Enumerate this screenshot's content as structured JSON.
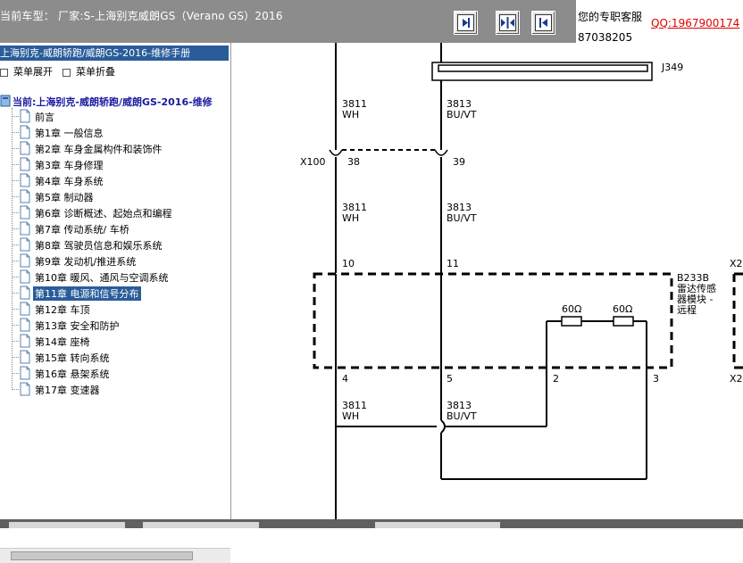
{
  "header": {
    "title": "当前车型： 厂家:S-上海别克威朗GS（Verano GS）2016",
    "buttons": [
      {
        "name": "first-page-button",
        "icon": "go-first-icon"
      },
      {
        "name": "split-view-button",
        "icon": "split-arrows-icon"
      },
      {
        "name": "previous-page-button",
        "icon": "go-back-icon"
      }
    ]
  },
  "support": {
    "label": "您的专职客服",
    "qq": "QQ:1967900174",
    "phone": "87038205"
  },
  "sidebar": {
    "header": "上海别克-威朗轿跑/威朗GS-2016-维修手册",
    "expand_menu": "菜单展开",
    "collapse_menu": "菜单折叠",
    "root": "当前:上海别克-威朗轿跑/威朗GS-2016-维修",
    "items": [
      {
        "label": "前言"
      },
      {
        "label": "第1章 一般信息"
      },
      {
        "label": "第2章 车身金属构件和装饰件"
      },
      {
        "label": "第3章 车身修理"
      },
      {
        "label": "第4章 车身系统"
      },
      {
        "label": "第5章 制动器"
      },
      {
        "label": "第6章 诊断概述、起始点和编程"
      },
      {
        "label": "第7章 传动系统/ 车桥"
      },
      {
        "label": "第8章 驾驶员信息和娱乐系统"
      },
      {
        "label": "第9章 发动机/推进系统"
      },
      {
        "label": "第10章 暖风、通风与空调系统"
      },
      {
        "label": "第11章 电源和信号分布"
      },
      {
        "label": "第12章 车顶"
      },
      {
        "label": "第13章 安全和防护"
      },
      {
        "label": "第14章 座椅"
      },
      {
        "label": "第15章 转向系统"
      },
      {
        "label": "第16章 悬架系统"
      },
      {
        "label": "第17章 变速器"
      }
    ],
    "selected_index": 11
  },
  "diagram": {
    "connector_top": "J349",
    "connector_mid": "X100",
    "connector_right_top": "X2",
    "connector_right_bottom": "X2",
    "wires": [
      {
        "circuit": "3811",
        "color": "WH"
      },
      {
        "circuit": "3813",
        "color": "BU/VT"
      }
    ],
    "x100_pins": [
      "38",
      "39"
    ],
    "module_pins_top": [
      "10",
      "11"
    ],
    "module_pins_bottom": [
      "4",
      "5",
      "2",
      "3"
    ],
    "module_name": [
      "B233B",
      "雷达传感",
      "器模块 -",
      "远程"
    ],
    "resistors": [
      "60Ω",
      "60Ω"
    ]
  }
}
